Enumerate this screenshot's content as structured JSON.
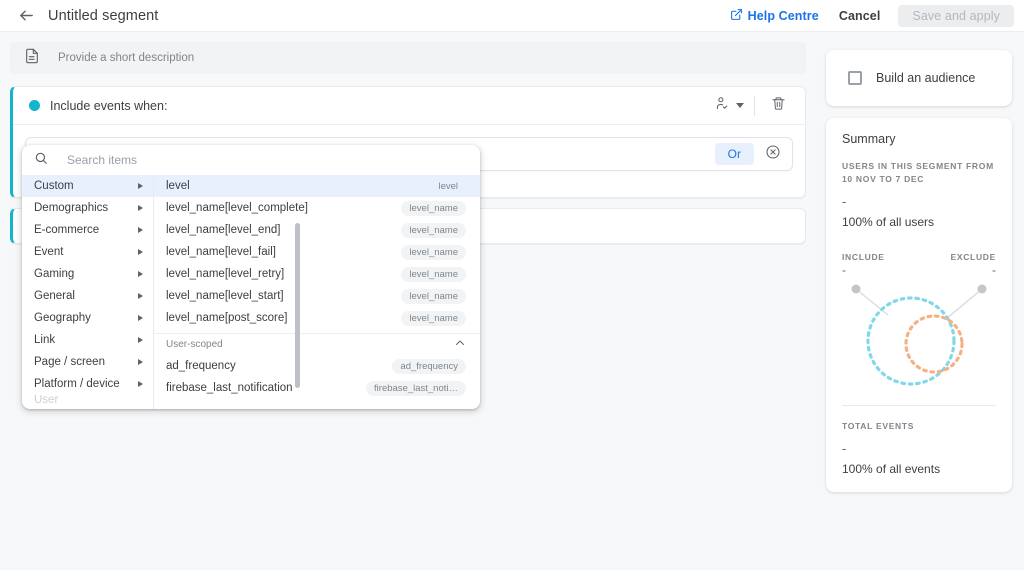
{
  "topbar": {
    "back_icon": "arrow-left-icon",
    "title": "Untitled segment",
    "help_icon": "external-link-icon",
    "help_label": "Help Centre",
    "cancel_label": "Cancel",
    "save_label": "Save and apply"
  },
  "description": {
    "icon": "document-icon",
    "placeholder": "Provide a short description"
  },
  "condition_card": {
    "title": "Include events when:",
    "scope_icon": "user-scope-icon",
    "dropdown_caret_icon": "chevron-down-icon",
    "delete_icon": "trash-icon",
    "or_label": "Or",
    "remove_icon": "close-circle-icon"
  },
  "dropdown": {
    "search_icon": "search-icon",
    "search_value": "",
    "search_placeholder": "Search items",
    "categories": [
      {
        "label": "Custom",
        "selected": true
      },
      {
        "label": "Demographics",
        "selected": false
      },
      {
        "label": "E-commerce",
        "selected": false
      },
      {
        "label": "Event",
        "selected": false
      },
      {
        "label": "Gaming",
        "selected": false
      },
      {
        "label": "General",
        "selected": false
      },
      {
        "label": "Geography",
        "selected": false
      },
      {
        "label": "Link",
        "selected": false
      },
      {
        "label": "Page / screen",
        "selected": false
      },
      {
        "label": "Platform / device",
        "selected": false
      }
    ],
    "options": [
      {
        "label": "level",
        "chip": "level",
        "selected": true
      },
      {
        "label": "level_name[level_complete]",
        "chip": "level_name",
        "selected": false
      },
      {
        "label": "level_name[level_end]",
        "chip": "level_name",
        "selected": false
      },
      {
        "label": "level_name[level_fail]",
        "chip": "level_name",
        "selected": false
      },
      {
        "label": "level_name[level_retry]",
        "chip": "level_name",
        "selected": false
      },
      {
        "label": "level_name[level_start]",
        "chip": "level_name",
        "selected": false
      },
      {
        "label": "level_name[post_score]",
        "chip": "level_name",
        "selected": false
      }
    ],
    "group_label": "User-scoped",
    "group_collapse_icon": "chevron-up-icon",
    "group_options": [
      {
        "label": "ad_frequency",
        "chip": "ad_frequency"
      },
      {
        "label": "firebase_last_notification",
        "chip": "firebase_last_noti…"
      }
    ]
  },
  "right_panel": {
    "audience": {
      "checkbox_state": "unchecked",
      "label": "Build an audience"
    },
    "summary": {
      "title": "Summary",
      "users_caption": "USERS IN THIS SEGMENT FROM 10 NOV TO 7 DEC",
      "users_value": "-",
      "users_percent": "100% of all users",
      "include_label": "INCLUDE",
      "exclude_label": "EXCLUDE",
      "include_value": "-",
      "exclude_value": "-",
      "total_events_label": "TOTAL EVENTS",
      "total_events_value": "-",
      "total_events_percent": "100% of all events"
    }
  },
  "colors": {
    "accent_teal": "#12b5cb",
    "link_blue": "#1a73e8",
    "chip_blue_bg": "#e8f0fe",
    "venn_outer": "#80d8e8",
    "venn_inner": "#f5b183",
    "page_bg": "#f7f8fa"
  }
}
